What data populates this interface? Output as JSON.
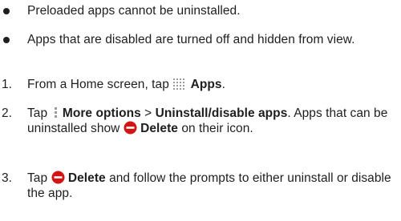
{
  "bullets": [
    "Preloaded apps cannot be uninstalled.",
    "Apps that are disabled are turned off and hidden from view."
  ],
  "steps": [
    {
      "number": "1.",
      "pre": "From a Home screen, tap",
      "icon": "apps-grid-icon",
      "bold": "Apps",
      "post": "."
    },
    {
      "number": "2.",
      "pre": "Tap",
      "icon": "more-options-icon",
      "bold": "More options",
      "sep": ">",
      "bold2": "Uninstall/disable apps",
      "post": ". Apps that can be uninstalled show",
      "icon2": "delete-icon",
      "bold3": "Delete",
      "post2": "on their icon."
    },
    {
      "number": "3.",
      "pre": "Tap",
      "icon": "delete-icon",
      "bold": "Delete",
      "post": "and follow the prompts to either uninstall or disable the app."
    }
  ],
  "colors": {
    "text": "#1e1e1e",
    "delete_icon": "#d21414",
    "grid_icon": "#9a9a9a"
  }
}
